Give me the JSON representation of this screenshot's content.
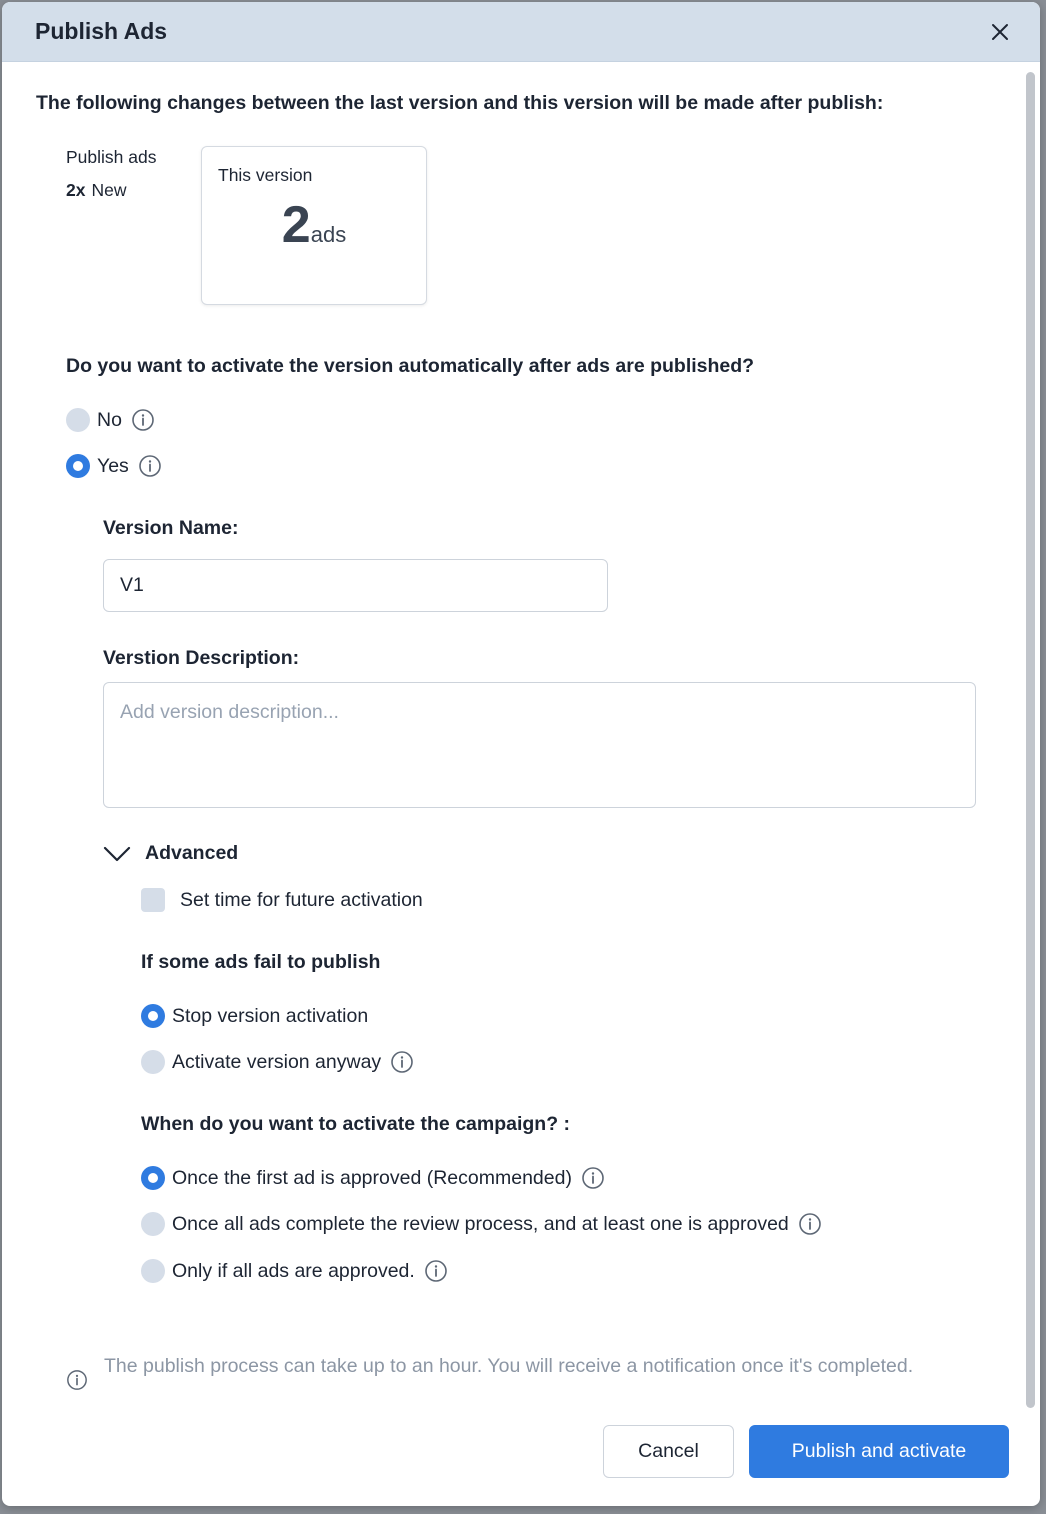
{
  "dialog": {
    "title": "Publish Ads",
    "intro": "The following changes between the last version and this version will be made after publish:"
  },
  "summary": {
    "publish_label": "Publish ads",
    "count_multiplier": "2x",
    "count_status": "New",
    "card_label": "This version",
    "card_count": "2",
    "card_unit": "ads"
  },
  "activation": {
    "question": "Do you want to activate the version automatically after ads are published?",
    "options": [
      {
        "label": "No",
        "selected": false
      },
      {
        "label": "Yes",
        "selected": true
      }
    ]
  },
  "version_form": {
    "name_label": "Version Name:",
    "name_value": "V1",
    "description_label": "Verstion Description:",
    "description_placeholder": "Add version description..."
  },
  "advanced": {
    "label": "Advanced",
    "future_activation_label": "Set time for future activation",
    "fail_heading": "If some ads fail to publish",
    "fail_options": [
      {
        "label": "Stop version activation",
        "selected": true
      },
      {
        "label": "Activate version anyway",
        "selected": false
      }
    ],
    "campaign_heading": "When do you want to activate the campaign? :",
    "campaign_options": [
      {
        "label": "Once the first ad is approved (Recommended)",
        "selected": true
      },
      {
        "label": "Once all ads complete the review process, and at least one is approved",
        "selected": false
      },
      {
        "label": "Only if all ads are approved.",
        "selected": false
      }
    ]
  },
  "note": "The publish process can take up to an hour. You will receive a notification once it's completed.",
  "footer": {
    "cancel_label": "Cancel",
    "primary_label": "Publish and activate"
  },
  "colors": {
    "accent": "#2f7be0",
    "header_bg": "#d3deea",
    "radio_off": "#d5dde8",
    "muted_text": "#8c96a4"
  },
  "icons": [
    "close-icon",
    "info-icon",
    "chevron-down-icon"
  ]
}
